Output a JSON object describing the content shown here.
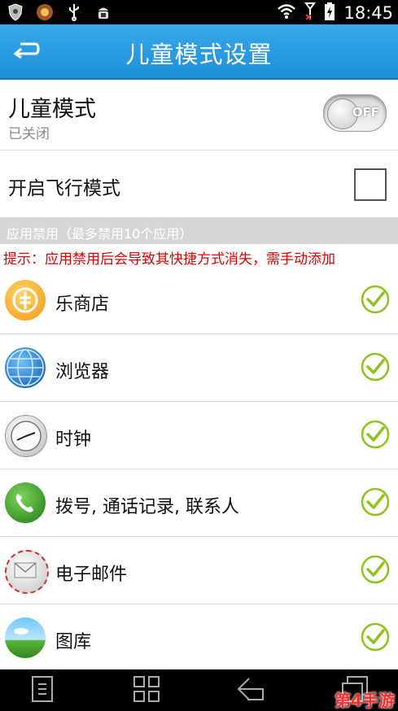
{
  "status_bar": {
    "time": "18:45"
  },
  "header": {
    "title": "儿童模式设置"
  },
  "kids_mode": {
    "label": "儿童模式",
    "status": "已关闭",
    "toggle_text": "OFF",
    "enabled": false
  },
  "airplane_mode": {
    "label": "开启飞行模式",
    "checked": false
  },
  "section": {
    "title": "应用禁用（最多禁用10个应用）"
  },
  "hint": "提示：应用禁用后会导致其快捷方式消失，需手动添加",
  "apps": [
    {
      "name": "乐商店",
      "icon": "store-icon",
      "allowed": true
    },
    {
      "name": "浏览器",
      "icon": "globe-icon",
      "allowed": true
    },
    {
      "name": "时钟",
      "icon": "clock-icon",
      "allowed": true
    },
    {
      "name": "拨号, 通话记录, 联系人",
      "icon": "phone-icon",
      "allowed": true
    },
    {
      "name": "电子邮件",
      "icon": "email-icon",
      "allowed": true
    },
    {
      "name": "图库",
      "icon": "gallery-icon",
      "allowed": true
    }
  ],
  "watermark": "第4手游",
  "colors": {
    "accent": "#1e8fd8",
    "check": "#8fc31f",
    "hint": "#e00000"
  }
}
